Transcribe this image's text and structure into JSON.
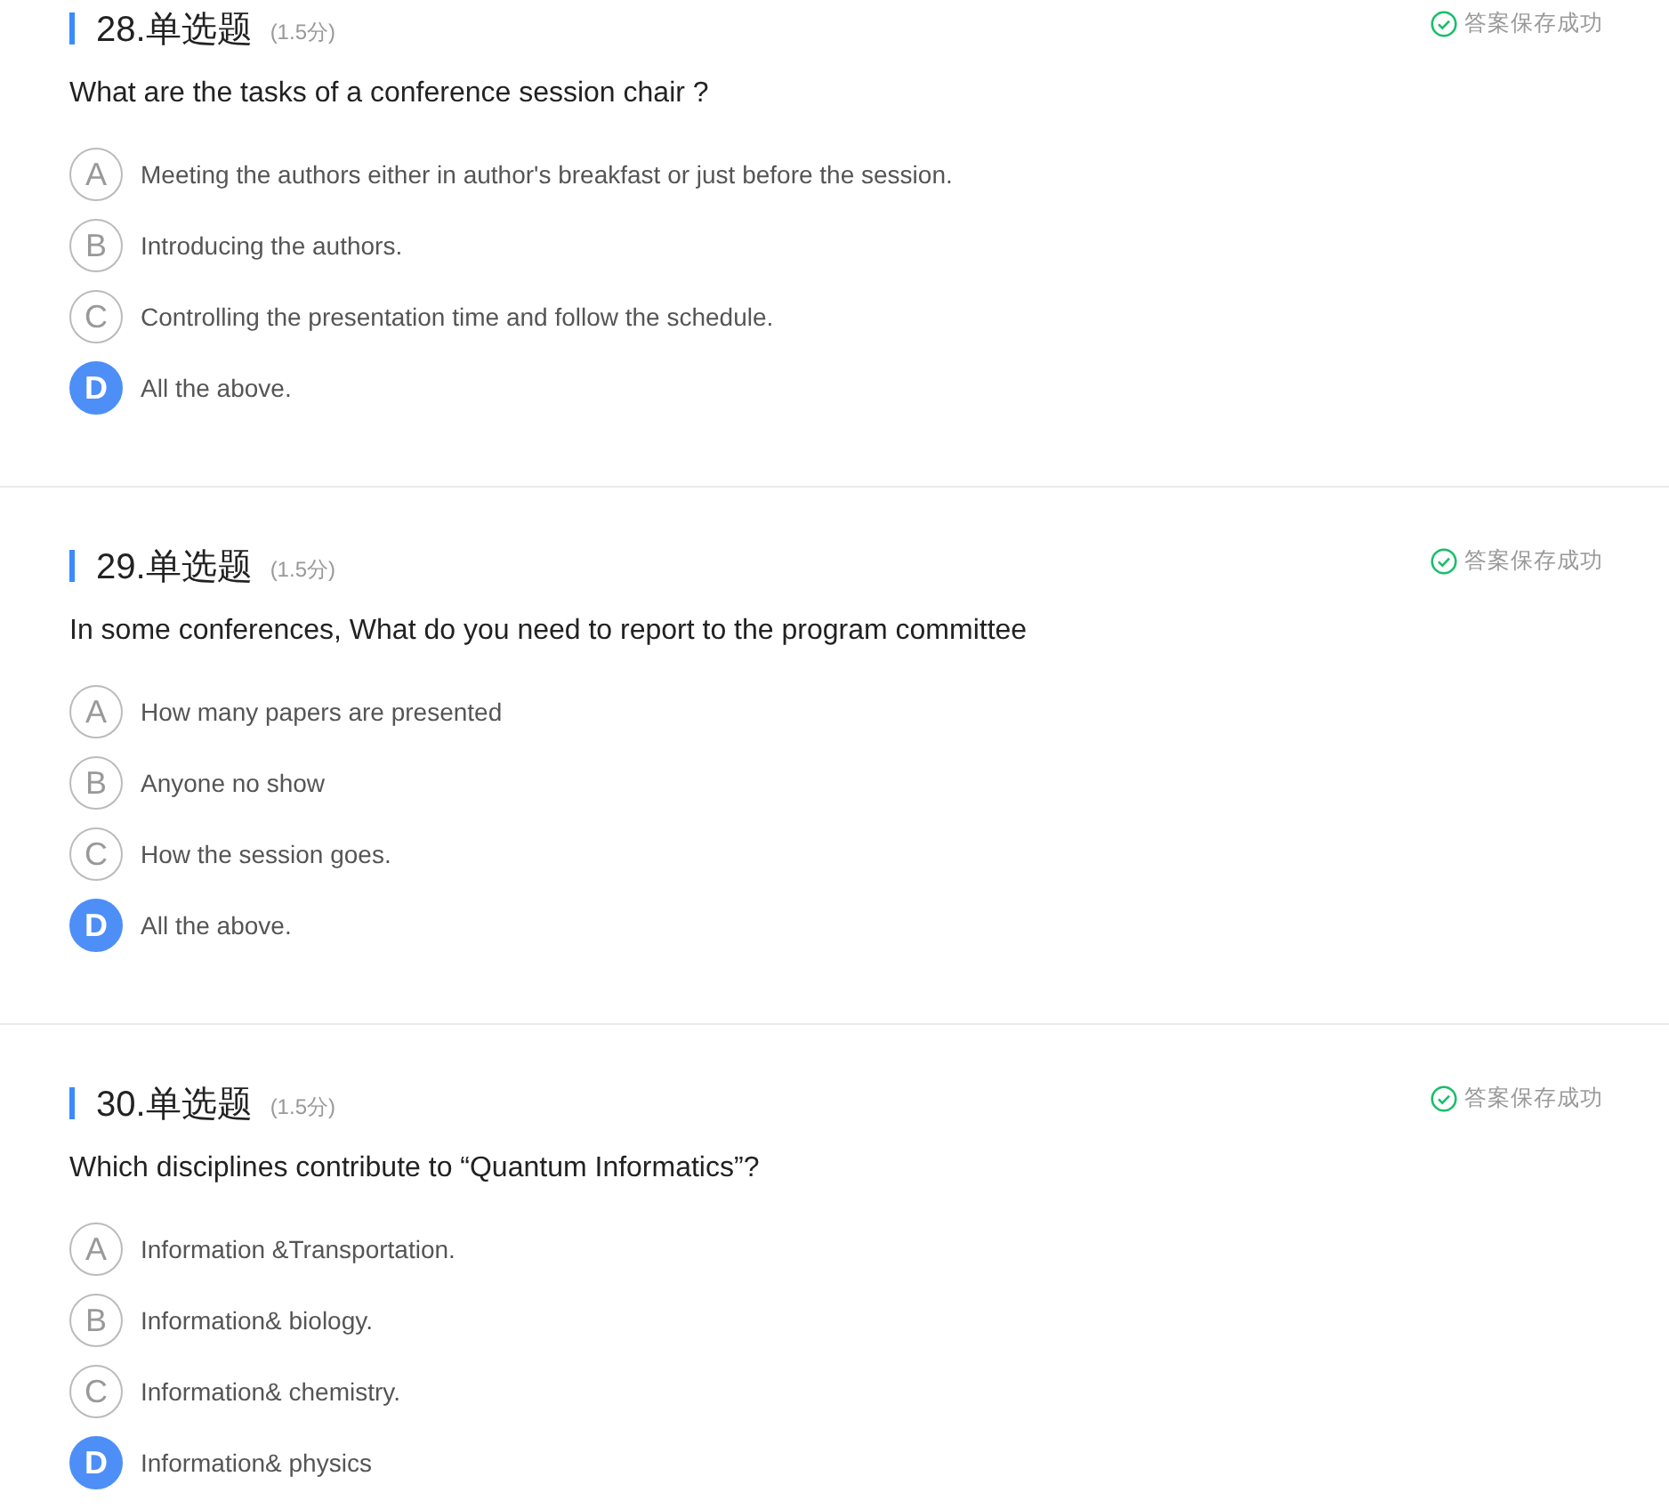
{
  "questions": [
    {
      "title": "28.单选题",
      "score": "(1.5分)",
      "status": "答案保存成功",
      "text": "What are the tasks of a conference session chair ?",
      "options": [
        {
          "letter": "A",
          "text": "Meeting the authors either in author's breakfast or just before the session.",
          "selected": false
        },
        {
          "letter": "B",
          "text": "Introducing the authors.",
          "selected": false
        },
        {
          "letter": "C",
          "text": "Controlling the presentation time and follow the schedule.",
          "selected": false
        },
        {
          "letter": "D",
          "text": "All the above.",
          "selected": true
        }
      ]
    },
    {
      "title": "29.单选题",
      "score": "(1.5分)",
      "status": "答案保存成功",
      "text": "In some conferences, What do you need to report to the program committee",
      "options": [
        {
          "letter": "A",
          "text": "How many papers are presented",
          "selected": false
        },
        {
          "letter": "B",
          "text": "Anyone no show",
          "selected": false
        },
        {
          "letter": "C",
          "text": "How the session goes.",
          "selected": false
        },
        {
          "letter": "D",
          "text": "All the above.",
          "selected": true
        }
      ]
    },
    {
      "title": "30.单选题",
      "score": "(1.5分)",
      "status": "答案保存成功",
      "text": "Which disciplines contribute to “Quantum Informatics”?",
      "options": [
        {
          "letter": "A",
          "text": "Information &Transportation.",
          "selected": false
        },
        {
          "letter": "B",
          "text": "Information& biology.",
          "selected": false
        },
        {
          "letter": "C",
          "text": "Information& chemistry.",
          "selected": false
        },
        {
          "letter": "D",
          "text": "Information& physics",
          "selected": true
        }
      ]
    }
  ]
}
